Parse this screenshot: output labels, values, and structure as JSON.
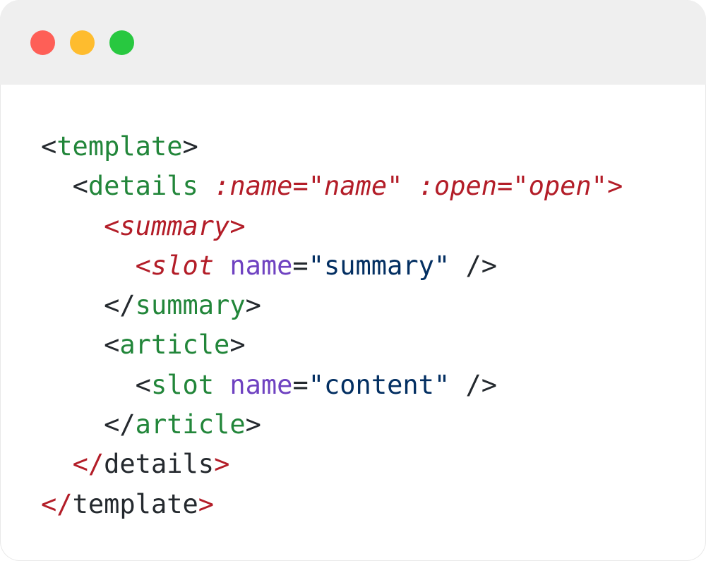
{
  "window": {
    "controls": [
      {
        "name": "close-button",
        "color": "#fe5f57"
      },
      {
        "name": "minimize-button",
        "color": "#febc2e"
      },
      {
        "name": "maximize-button",
        "color": "#28c840"
      }
    ]
  },
  "colors": {
    "background": "#ffffff",
    "titlebar": "#efefef",
    "punctuation": "#24292e",
    "tag": "#22863a",
    "attribute-italic": "#b31d28",
    "attr-name": "#6f42c1",
    "string": "#032f62"
  },
  "code": {
    "language": "vue",
    "lines": [
      {
        "indent": 0,
        "tokens": [
          {
            "t": "<",
            "c": "#24292e"
          },
          {
            "t": "template",
            "c": "#22863a"
          },
          {
            "t": ">",
            "c": "#24292e"
          }
        ]
      },
      {
        "indent": 1,
        "tokens": [
          {
            "t": "<",
            "c": "#24292e"
          },
          {
            "t": "details",
            "c": "#22863a"
          },
          {
            "t": " ",
            "c": "#24292e"
          },
          {
            "t": ":name=\"name\" :open=\"open\">",
            "c": "#b31d28",
            "i": true
          }
        ]
      },
      {
        "indent": 2,
        "tokens": [
          {
            "t": "<summary>",
            "c": "#b31d28",
            "i": true
          }
        ]
      },
      {
        "indent": 3,
        "tokens": [
          {
            "t": "<slot ",
            "c": "#b31d28",
            "i": true
          },
          {
            "t": "name",
            "c": "#6f42c1"
          },
          {
            "t": "=",
            "c": "#24292e"
          },
          {
            "t": "\"summary\"",
            "c": "#032f62"
          },
          {
            "t": " />",
            "c": "#24292e"
          }
        ]
      },
      {
        "indent": 2,
        "tokens": [
          {
            "t": "</",
            "c": "#24292e"
          },
          {
            "t": "summary",
            "c": "#22863a"
          },
          {
            "t": ">",
            "c": "#24292e"
          }
        ]
      },
      {
        "indent": 2,
        "tokens": [
          {
            "t": "<",
            "c": "#24292e"
          },
          {
            "t": "article",
            "c": "#22863a"
          },
          {
            "t": ">",
            "c": "#24292e"
          }
        ]
      },
      {
        "indent": 3,
        "tokens": [
          {
            "t": "<",
            "c": "#24292e"
          },
          {
            "t": "slot",
            "c": "#22863a"
          },
          {
            "t": " ",
            "c": "#24292e"
          },
          {
            "t": "name",
            "c": "#6f42c1"
          },
          {
            "t": "=",
            "c": "#24292e"
          },
          {
            "t": "\"content\"",
            "c": "#032f62"
          },
          {
            "t": " />",
            "c": "#24292e"
          }
        ]
      },
      {
        "indent": 2,
        "tokens": [
          {
            "t": "</",
            "c": "#24292e"
          },
          {
            "t": "article",
            "c": "#22863a"
          },
          {
            "t": ">",
            "c": "#24292e"
          }
        ]
      },
      {
        "indent": 1,
        "tokens": [
          {
            "t": "</",
            "c": "#b31d28"
          },
          {
            "t": "details",
            "c": "#24292e"
          },
          {
            "t": ">",
            "c": "#b31d28"
          }
        ]
      },
      {
        "indent": 0,
        "tokens": [
          {
            "t": "</",
            "c": "#b31d28"
          },
          {
            "t": "template",
            "c": "#24292e"
          },
          {
            "t": ">",
            "c": "#b31d28"
          }
        ]
      }
    ]
  }
}
